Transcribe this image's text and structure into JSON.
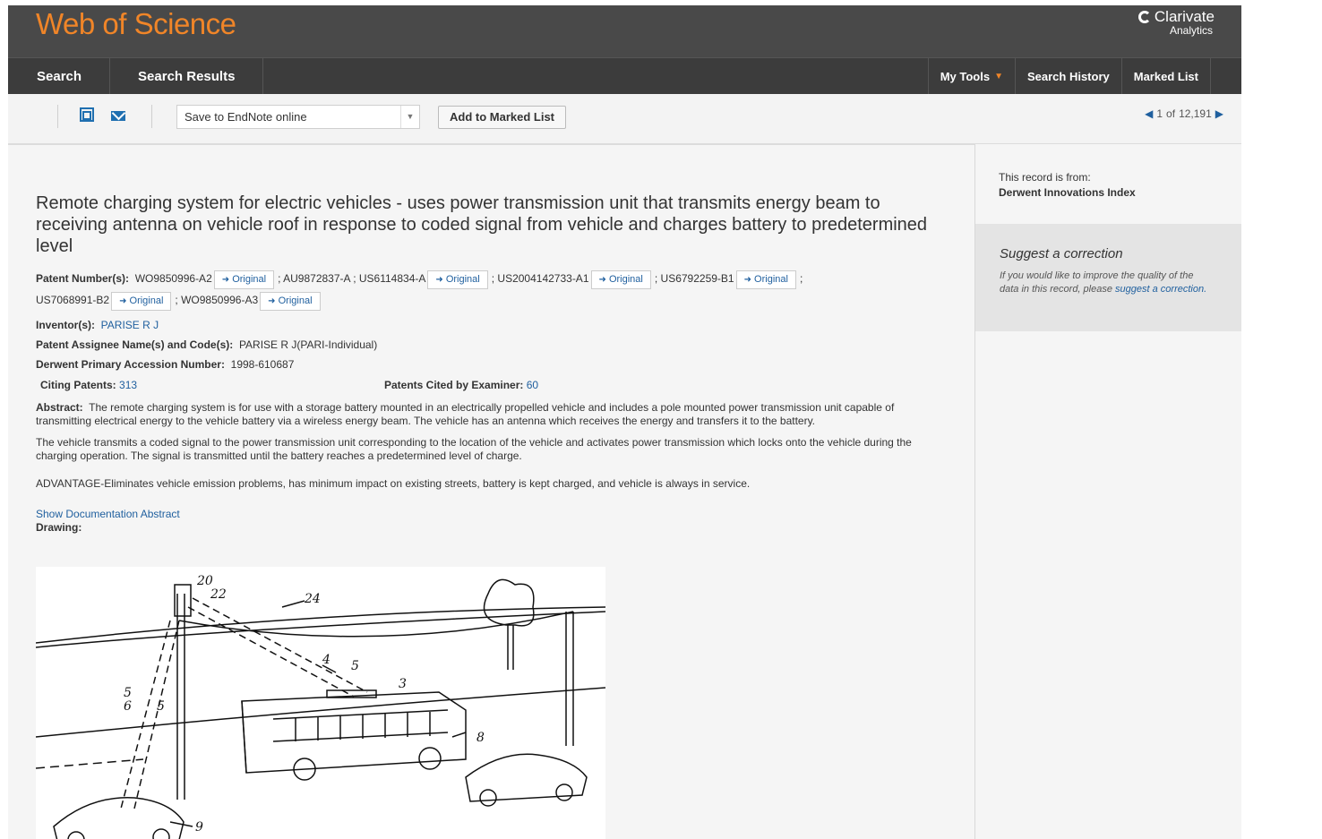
{
  "header": {
    "logo": "Web of Science",
    "brand": "Clarivate",
    "brand_sub": "Analytics"
  },
  "nav": {
    "search": "Search",
    "search_results": "Search Results",
    "my_tools": "My Tools",
    "search_history": "Search History",
    "marked_list": "Marked List"
  },
  "toolbar": {
    "save_option": "Save to EndNote online",
    "add_marked": "Add to Marked List",
    "pager_current": "1",
    "pager_of": "of",
    "pager_total": "12,191"
  },
  "record": {
    "title": "Remote charging system for electric vehicles - uses power transmission unit that transmits energy beam to receiving antenna on vehicle roof in response to coded signal from vehicle and charges battery to predetermined level",
    "patent_label": "Patent Number(s):",
    "patents": [
      "WO9850996-A2",
      "AU9872837-A",
      "US6114834-A",
      "US2004142733-A1",
      "US6792259-B1",
      "US7068991-B2",
      "WO9850996-A3"
    ],
    "original_label": "Original",
    "inventor_label": "Inventor(s):",
    "inventor": "PARISE R J",
    "assignee_label": "Patent Assignee Name(s) and Code(s):",
    "assignee": "PARISE R J(PARI-Individual)",
    "accession_label": "Derwent Primary Accession Number:",
    "accession": "1998-610687",
    "citing_label": "Citing Patents:",
    "citing": "313",
    "cited_label": "Patents Cited by Examiner:",
    "cited": "60",
    "abstract_label": "Abstract:",
    "abstract": "The remote charging system is for use with a storage battery mounted in an electrically propelled vehicle and includes a pole mounted power transmission unit capable of transmitting electrical energy to the vehicle battery via a wireless energy beam. The vehicle has an antenna which receives the energy and transfers it to the battery.",
    "para2": "The vehicle transmits a coded signal to the power transmission unit corresponding to the location of the vehicle and activates power transmission which locks onto the vehicle during the charging operation. The signal is transmitted until the battery reaches a predetermined level of charge.",
    "para3": "ADVANTAGE-Eliminates vehicle emission problems, has minimum impact on existing streets, battery is kept charged, and vehicle is always in service.",
    "show_doc": "Show Documentation Abstract",
    "drawing_label": "Drawing:",
    "drawing_numbers": [
      "20",
      "22",
      "24",
      "4",
      "5",
      "3",
      "5",
      "6",
      "5",
      "8",
      "9"
    ]
  },
  "sidebar": {
    "from_label": "This record is from:",
    "from_value": "Derwent Innovations Index",
    "suggest_title": "Suggest a correction",
    "suggest_text": "If you would like to improve the quality of the data in this record, please",
    "suggest_link": "suggest a correction."
  }
}
